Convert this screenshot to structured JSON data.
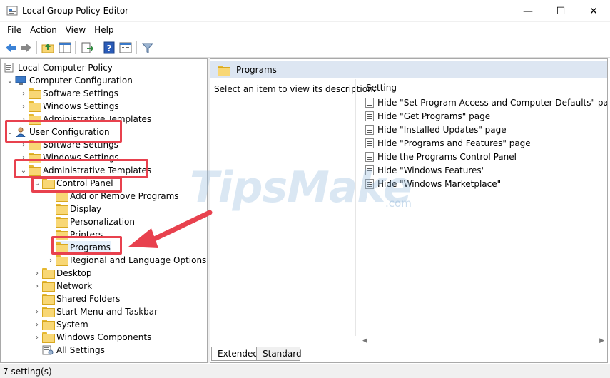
{
  "window": {
    "title": "Local Group Policy Editor",
    "controls": {
      "minimize": "—",
      "maximize": "☐",
      "close": "✕"
    }
  },
  "menu": [
    "File",
    "Action",
    "View",
    "Help"
  ],
  "toolbar": {
    "icons": [
      "back-arrow-icon",
      "forward-arrow-icon",
      "up-folder-icon",
      "show-hide-tree-icon",
      "export-list-icon",
      "help-icon",
      "properties-icon",
      "filter-icon"
    ]
  },
  "tree": {
    "items": [
      {
        "label": "Local Computer Policy",
        "icon": "computer-policy-icon"
      },
      {
        "label": "Computer Configuration",
        "icon": "computer-icon",
        "expanded": true
      },
      {
        "label": "Software Settings",
        "icon": "folder-icon"
      },
      {
        "label": "Windows Settings",
        "icon": "folder-icon"
      },
      {
        "label": "Administrative Templates",
        "icon": "folder-icon"
      },
      {
        "label": "User Configuration",
        "icon": "user-icon",
        "expanded": true
      },
      {
        "label": "Software Settings",
        "icon": "folder-icon"
      },
      {
        "label": "Windows Settings",
        "icon": "folder-icon"
      },
      {
        "label": "Administrative Templates",
        "icon": "folder-icon",
        "expanded": true
      },
      {
        "label": "Control Panel",
        "icon": "folder-icon",
        "expanded": true
      },
      {
        "label": "Add or Remove Programs",
        "icon": "folder-icon"
      },
      {
        "label": "Display",
        "icon": "folder-icon"
      },
      {
        "label": "Personalization",
        "icon": "folder-icon"
      },
      {
        "label": "Printers",
        "icon": "folder-icon"
      },
      {
        "label": "Programs",
        "icon": "folder-icon",
        "selected": true
      },
      {
        "label": "Regional and Language Options",
        "icon": "folder-icon"
      },
      {
        "label": "Desktop",
        "icon": "folder-icon"
      },
      {
        "label": "Network",
        "icon": "folder-icon"
      },
      {
        "label": "Shared Folders",
        "icon": "folder-icon"
      },
      {
        "label": "Start Menu and Taskbar",
        "icon": "folder-icon"
      },
      {
        "label": "System",
        "icon": "folder-icon"
      },
      {
        "label": "Windows Components",
        "icon": "folder-icon"
      },
      {
        "label": "All Settings",
        "icon": "all-settings-icon"
      }
    ]
  },
  "details": {
    "header": "Programs",
    "description": "Select an item to view its description.",
    "column": "Setting",
    "settings": [
      "Hide \"Set Program Access and Computer Defaults\" page",
      "Hide \"Get Programs\" page",
      "Hide \"Installed Updates\" page",
      "Hide \"Programs and Features\" page",
      "Hide the Programs Control Panel",
      "Hide \"Windows Features\"",
      "Hide \"Windows Marketplace\""
    ]
  },
  "tabs": [
    "Extended",
    "Standard"
  ],
  "status": "7 setting(s)",
  "watermark": {
    "main": "TipsMake",
    "sub": ".com"
  },
  "colors": {
    "highlight": "#e8414e",
    "header_band": "#dde6f2",
    "folder": "#f8d775"
  }
}
